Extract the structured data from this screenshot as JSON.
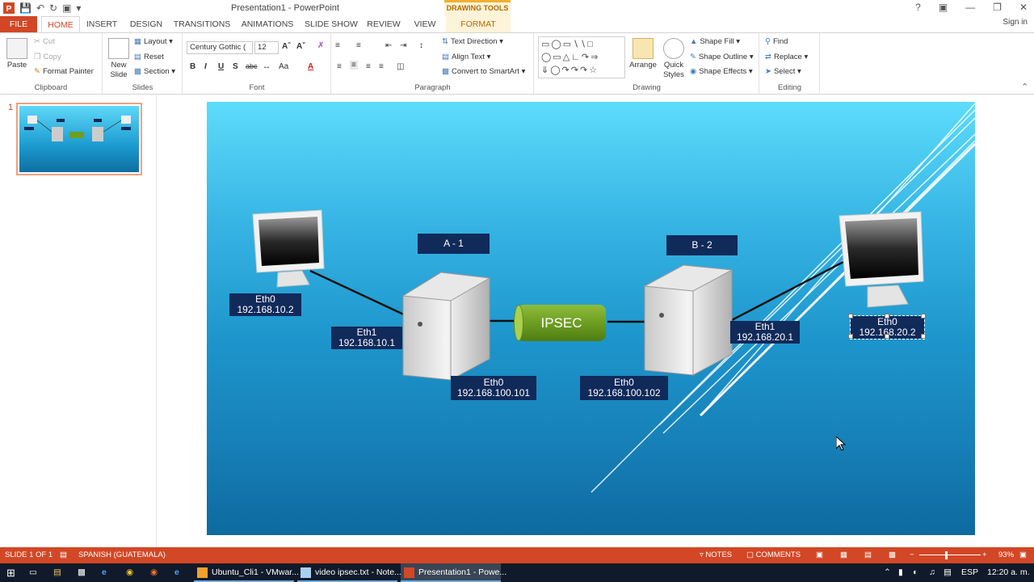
{
  "window": {
    "title": "Presentation1 - PowerPoint",
    "contextual_tab_group": "DRAWING TOOLS",
    "sign_in": "Sign in",
    "help": "?"
  },
  "tabs": [
    "FILE",
    "HOME",
    "INSERT",
    "DESIGN",
    "TRANSITIONS",
    "ANIMATIONS",
    "SLIDE SHOW",
    "REVIEW",
    "VIEW",
    "FORMAT"
  ],
  "ribbon": {
    "clipboard": {
      "label": "Clipboard",
      "paste": "Paste",
      "cut": "Cut",
      "copy": "Copy",
      "format_painter": "Format Painter"
    },
    "slides": {
      "label": "Slides",
      "new_slide_1": "New",
      "new_slide_2": "Slide",
      "layout": "Layout",
      "reset": "Reset",
      "section": "Section"
    },
    "font": {
      "label": "Font",
      "family": "Century Gothic (",
      "size": "12"
    },
    "paragraph": {
      "label": "Paragraph",
      "text_direction": "Text Direction",
      "align_text": "Align Text",
      "convert_smartart": "Convert to SmartArt"
    },
    "drawing": {
      "label": "Drawing",
      "arrange": "Arrange",
      "quick_styles_1": "Quick",
      "quick_styles_2": "Styles",
      "shape_fill": "Shape Fill",
      "shape_outline": "Shape Outline",
      "shape_effects": "Shape Effects"
    },
    "editing": {
      "label": "Editing",
      "find": "Find",
      "replace": "Replace",
      "select": "Select"
    }
  },
  "thumbnail": {
    "number": "1"
  },
  "slide": {
    "hosts": {
      "a": "A - 1",
      "b": "B - 2"
    },
    "tunnel": "IPSEC",
    "labels": {
      "pc_left_if": "Eth0",
      "pc_left_ip": "192.168.10.2",
      "a_eth1_if": "Eth1",
      "a_eth1_ip": "192.168.10.1",
      "a_eth0_if": "Eth0",
      "a_eth0_ip": "192.168.100.101",
      "b_eth0_if": "Eth0",
      "b_eth0_ip": "192.168.100.102",
      "b_eth1_if": "Eth1",
      "b_eth1_ip": "192.168.20.1",
      "pc_right_if": "Eth0",
      "pc_right_ip": "192.168.20.2"
    }
  },
  "statusbar": {
    "slide_count": "SLIDE 1 OF 1",
    "language": "SPANISH (GUATEMALA)",
    "notes": "NOTES",
    "comments": "COMMENTS",
    "zoom": "93%"
  },
  "taskbar": {
    "apps": [
      "Ubuntu_Cli1 - VMwar...",
      "video ipsec.txt - Note...",
      "Presentation1 - Powe..."
    ],
    "lang": "ESP",
    "time": "12:20 a. m."
  },
  "colors": {
    "accent": "#d24726",
    "label_bg": "#102a5a",
    "tunnel": "#6d9e22"
  }
}
